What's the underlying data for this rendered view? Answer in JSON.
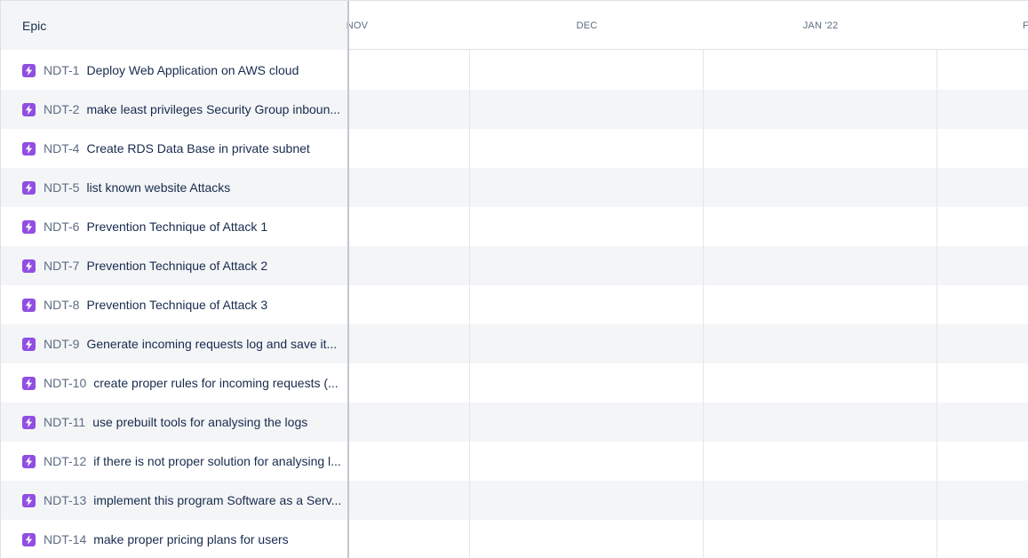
{
  "header": {
    "epic_column_label": "Epic",
    "months": [
      "NOV",
      "DEC",
      "JAN '22",
      "F"
    ]
  },
  "epics": [
    {
      "key": "NDT-1",
      "summary": "Deploy Web Application on AWS cloud"
    },
    {
      "key": "NDT-2",
      "summary": "make least privileges Security Group inboun..."
    },
    {
      "key": "NDT-4",
      "summary": "Create RDS Data Base in private subnet"
    },
    {
      "key": "NDT-5",
      "summary": "list known website Attacks"
    },
    {
      "key": "NDT-6",
      "summary": "Prevention Technique of Attack 1"
    },
    {
      "key": "NDT-7",
      "summary": "Prevention Technique of Attack 2"
    },
    {
      "key": "NDT-8",
      "summary": "Prevention Technique of Attack 3"
    },
    {
      "key": "NDT-9",
      "summary": "Generate incoming requests log and save it..."
    },
    {
      "key": "NDT-10",
      "summary": "create proper rules for incoming requests (..."
    },
    {
      "key": "NDT-11",
      "summary": "use prebuilt tools for analysing the logs"
    },
    {
      "key": "NDT-12",
      "summary": "if there is not proper solution for analysing l..."
    },
    {
      "key": "NDT-13",
      "summary": "implement this program Software as a Serv..."
    },
    {
      "key": "NDT-14",
      "summary": "make proper pricing plans for users"
    }
  ],
  "colors": {
    "epic_icon": "#904ee2",
    "alt_row": "#f4f5f7",
    "key_text": "#5e6c84",
    "summary_text": "#172b4d"
  }
}
